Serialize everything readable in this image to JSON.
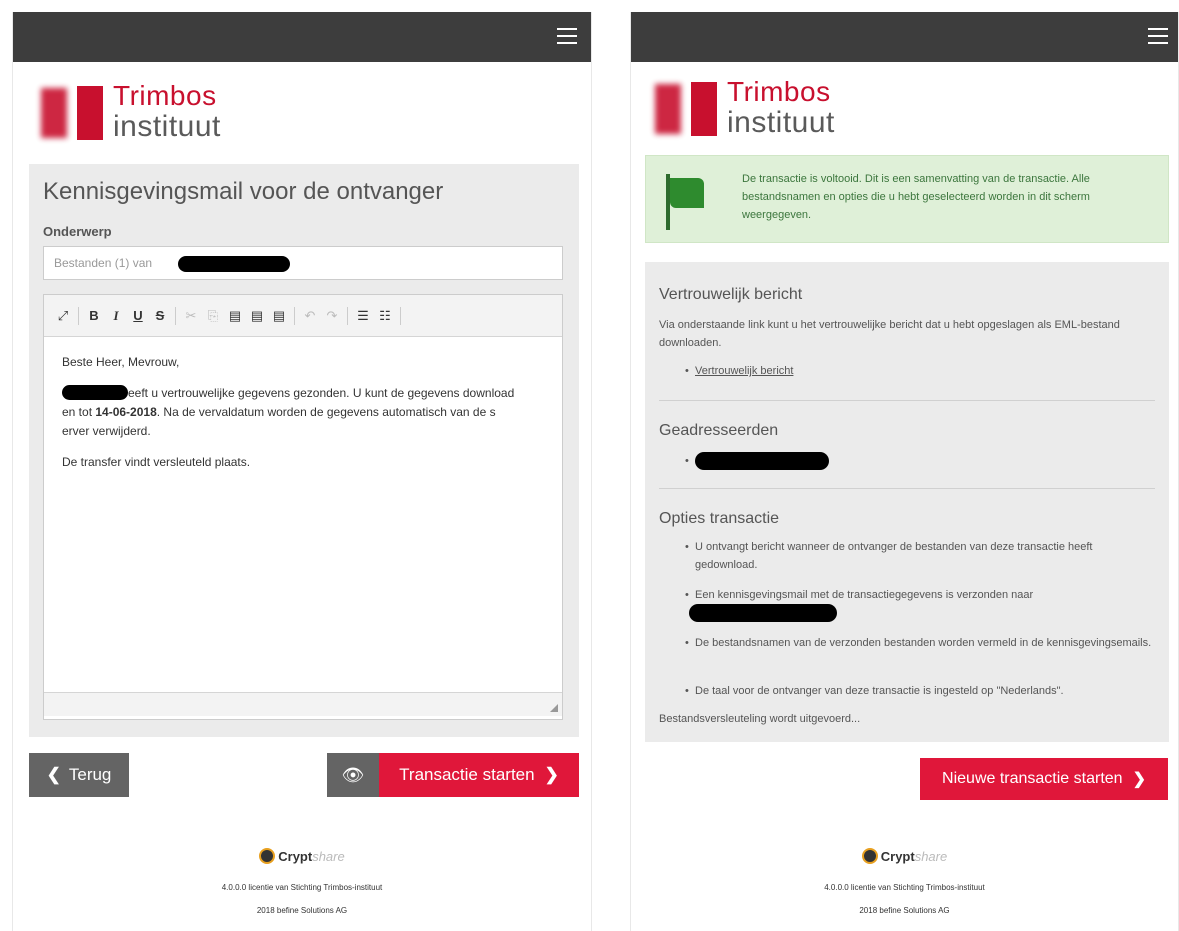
{
  "left": {
    "panel_title": "Kennisgevingsmail voor de ontvanger",
    "subject_label": "Onderwerp",
    "subject_value": "Bestanden (1) van",
    "body": {
      "greeting": "Beste Heer, Mevrouw,",
      "line1_tail": "eeft u vertrouwelijke gegevens gezonden. U kunt de gegevens download",
      "line2_start": "en tot ",
      "date": "14-06-2018",
      "line2_tail": ". Na de vervaldatum worden de gegevens automatisch van de s",
      "line3": "erver verwijderd.",
      "transfer": "De transfer vindt versleuteld plaats."
    },
    "toolbar_icons": [
      "fullscreen-icon",
      "bold-icon",
      "italic-icon",
      "underline-icon",
      "strikethrough-icon",
      "cut-icon",
      "copy-icon",
      "paste-icon",
      "paste-text-icon",
      "paste-word-icon",
      "undo-icon",
      "redo-icon",
      "numbered-list-icon",
      "bullet-list-icon"
    ],
    "back_label": "Terug",
    "start_label": "Transactie starten"
  },
  "right": {
    "alert_text": "De transactie is voltooid. Dit is een samenvatting van de transactie. Alle bestandsnamen en opties die u hebt geselecteerd worden in dit scherm weergegeven.",
    "sections": {
      "confidential_title": "Vertrouwelijk bericht",
      "confidential_text": "Via onderstaande link kunt u het vertrouwelijke bericht dat u hebt opgeslagen als EML-bestand downloaden.",
      "confidential_link": "Vertrouwelijk bericht",
      "recipients_title": "Geadresseerden",
      "options_title": "Opties transactie",
      "options": [
        "U ontvangt bericht wanneer de ontvanger de bestanden van deze transactie heeft gedownload.",
        "Een kennisgevingsmail met de transactiegegevens is verzonden naar",
        "De bestandsnamen van de verzonden bestanden worden vermeld in de kennisgevingsemails.",
        "De taal voor de ontvanger van deze transactie is ingesteld op \"Nederlands\"."
      ],
      "encryption_status": "Bestandsversleuteling wordt uitgevoerd..."
    },
    "new_transaction_label": "Nieuwe transactie starten"
  },
  "brand": {
    "logo_word1": "Trimbos",
    "logo_word2": "instituut",
    "red": "#c8102e",
    "button_red": "#e0173a",
    "topbar": "#3d3d3d"
  },
  "footer": {
    "crypt": "Crypt",
    "share": "share",
    "license": "4.0.0.0 licentie van Stichting Trimbos-instituut",
    "copyright": "2018 befine Solutions AG"
  }
}
